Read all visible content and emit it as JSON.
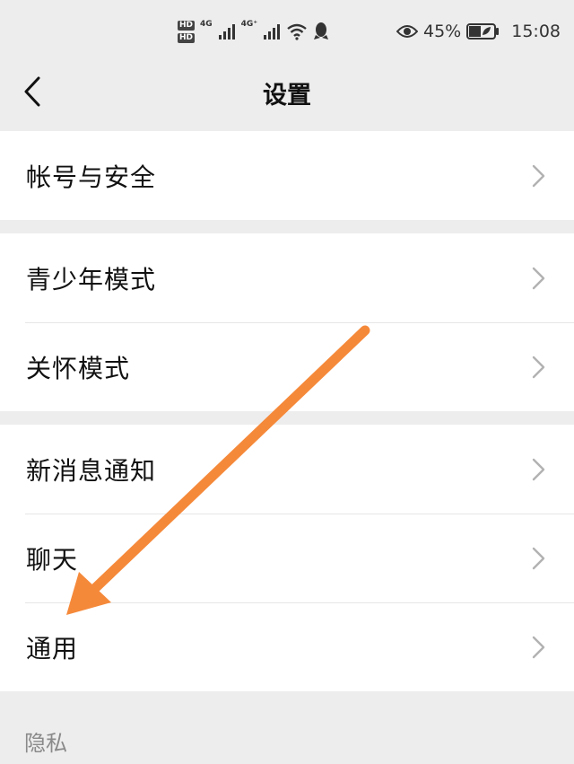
{
  "status_bar": {
    "hd1": "HD",
    "hd2": "HD",
    "network1": "4G",
    "network2": "4G⁺",
    "battery_percent": "45%",
    "time": "15:08",
    "icons": [
      "signal-icon",
      "wifi-icon",
      "qq-icon",
      "eye-icon",
      "battery-icon"
    ]
  },
  "header": {
    "title": "设置",
    "back_icon": "chevron-left-icon"
  },
  "groups": [
    {
      "items": [
        {
          "label": "帐号与安全"
        }
      ]
    },
    {
      "items": [
        {
          "label": "青少年模式"
        },
        {
          "label": "关怀模式"
        }
      ]
    },
    {
      "items": [
        {
          "label": "新消息通知"
        },
        {
          "label": "聊天"
        },
        {
          "label": "通用"
        }
      ]
    }
  ],
  "section": {
    "privacy_label": "隐私"
  },
  "annotation": {
    "arrow_color": "#f5893a"
  },
  "colors": {
    "background": "#ededed",
    "card": "#ffffff",
    "divider": "#e6e6e6",
    "chevron": "#b2b2b2"
  }
}
